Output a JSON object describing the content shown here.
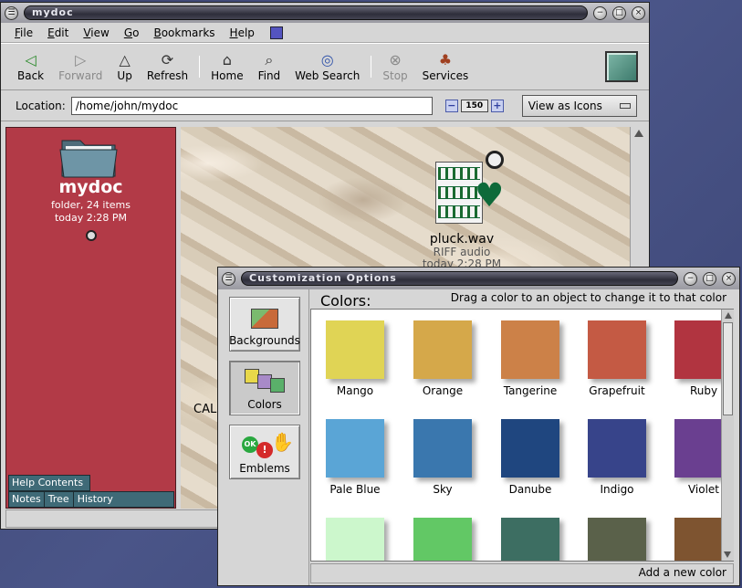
{
  "main_window": {
    "title": "mydoc",
    "menu": [
      "File",
      "Edit",
      "View",
      "Go",
      "Bookmarks",
      "Help"
    ],
    "toolbar": [
      {
        "label": "Back",
        "icon": "back-arrow-icon",
        "enabled": true
      },
      {
        "label": "Forward",
        "icon": "forward-arrow-icon",
        "enabled": false
      },
      {
        "label": "Up",
        "icon": "up-arrow-icon",
        "enabled": true
      },
      {
        "label": "Refresh",
        "icon": "refresh-icon",
        "enabled": true
      },
      {
        "label": "Home",
        "icon": "home-icon",
        "enabled": true
      },
      {
        "label": "Find",
        "icon": "find-icon",
        "enabled": true
      },
      {
        "label": "Web Search",
        "icon": "web-search-icon",
        "enabled": true
      },
      {
        "label": "Stop",
        "icon": "stop-icon",
        "enabled": false
      },
      {
        "label": "Services",
        "icon": "services-icon",
        "enabled": true
      }
    ],
    "location_label": "Location:",
    "location_value": "/home/john/mydoc",
    "zoom_value": "150",
    "view_mode": "View as Icons",
    "sidebar": {
      "folder_name": "mydoc",
      "info_line1": "folder, 24 items",
      "info_line2": "today 2:28 PM",
      "tabs": [
        "Help Contents",
        "Notes",
        "Tree",
        "History"
      ]
    },
    "file_icon": {
      "name": "pluck.wav",
      "type": "RIFF audio",
      "date": "today 2:28 PM"
    },
    "partial_label": "CAL"
  },
  "dialog": {
    "title": "Customization Options",
    "categories": [
      "Backgrounds",
      "Colors",
      "Emblems"
    ],
    "selected_category": "Colors",
    "heading": "Colors:",
    "hint": "Drag a color to an object to change it to that color",
    "button": "Add a new color",
    "colors": [
      {
        "name": "Mango",
        "hex": "#e0d455"
      },
      {
        "name": "Orange",
        "hex": "#d5a84a"
      },
      {
        "name": "Tangerine",
        "hex": "#cc8148"
      },
      {
        "name": "Grapefruit",
        "hex": "#c45a44"
      },
      {
        "name": "Ruby",
        "hex": "#b13440"
      },
      {
        "name": "Pale Blue",
        "hex": "#5aa5d6"
      },
      {
        "name": "Sky",
        "hex": "#3a77ae"
      },
      {
        "name": "Danube",
        "hex": "#1f467f"
      },
      {
        "name": "Indigo",
        "hex": "#37448a"
      },
      {
        "name": "Violet",
        "hex": "#6a3f90"
      },
      {
        "name": "",
        "hex": "#ccf7cc"
      },
      {
        "name": "",
        "hex": "#62c865"
      },
      {
        "name": "",
        "hex": "#3d6e62"
      },
      {
        "name": "",
        "hex": "#5a614a"
      },
      {
        "name": "",
        "hex": "#7e5430"
      }
    ]
  }
}
